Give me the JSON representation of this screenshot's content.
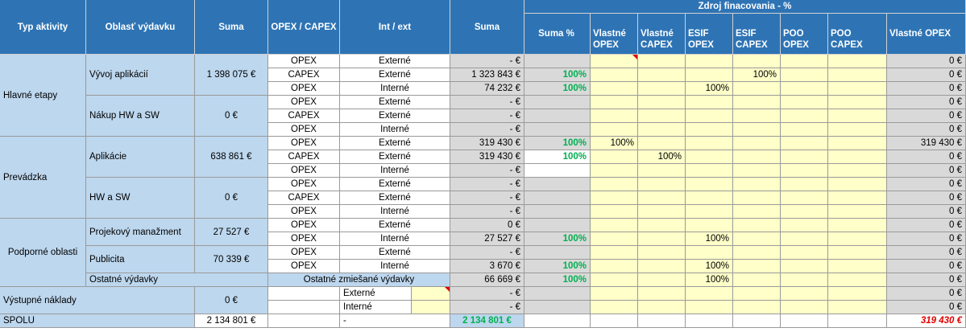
{
  "headers": {
    "typ_aktivity": "Typ aktivity",
    "oblast_vydavku": "Oblasť výdavku",
    "suma": "Suma",
    "opex_capex": "OPEX / CAPEX",
    "int_ext": "Int / ext",
    "suma2": "Suma",
    "zdroj": "Zdroj finacovania - %",
    "suma_pct": "Suma %",
    "vlastne_opex": "Vlastné OPEX",
    "vlastne_capex": "Vlastné CAPEX",
    "esif_opex": "ESIF OPEX",
    "esif_capex": "ESIF CAPEX",
    "poo_opex": "POO OPEX",
    "poo_capex": "POO CAPEX",
    "vlastne_opex2": "Vlastné OPEX"
  },
  "groups": {
    "hlavne": "Hlavné etapy",
    "prevadzka": "Prevádzka",
    "podporne": "Podporné oblasti",
    "vystupne": "Výstupné náklady",
    "spolu": "SPOLU"
  },
  "areas": {
    "vyvoj": "Vývoj aplikácií",
    "vyvoj_sum": "1 398 075 €",
    "nakup": "Nákup HW a SW",
    "nakup_sum": "0 €",
    "aplikacie": "Aplikácie",
    "aplikacie_sum": "638 861 €",
    "hwsw": "HW a SW",
    "hwsw_sum": "0 €",
    "projekt": "Projekový manažment",
    "projekt_sum": "27 527 €",
    "publicita": "Publicita",
    "publicita_sum": "70 339 €",
    "ostatne": "Ostatné výdavky",
    "vystupne_sum": "0 €",
    "spolu_sum": "2 134 801 €"
  },
  "rows": [
    {
      "oc": "OPEX",
      "ie": "Externé",
      "suma": "- €",
      "pct": "",
      "vo": "",
      "vc": "",
      "eo": "",
      "ec": "",
      "po": "",
      "pc": "",
      "v2": "0 €"
    },
    {
      "oc": "CAPEX",
      "ie": "Externé",
      "suma": "1 323 843 €",
      "pct": "100%",
      "vo": "",
      "vc": "",
      "eo": "",
      "ec": "100%",
      "po": "",
      "pc": "",
      "v2": "0 €"
    },
    {
      "oc": "OPEX",
      "ie": "Interné",
      "suma": "74 232 €",
      "pct": "100%",
      "vo": "",
      "vc": "",
      "eo": "100%",
      "ec": "",
      "po": "",
      "pc": "",
      "v2": "0 €"
    },
    {
      "oc": "OPEX",
      "ie": "Externé",
      "suma": "- €",
      "pct": "",
      "vo": "",
      "vc": "",
      "eo": "",
      "ec": "",
      "po": "",
      "pc": "",
      "v2": "0 €"
    },
    {
      "oc": "CAPEX",
      "ie": "Externé",
      "suma": "- €",
      "pct": "",
      "vo": "",
      "vc": "",
      "eo": "",
      "ec": "",
      "po": "",
      "pc": "",
      "v2": "0 €"
    },
    {
      "oc": "OPEX",
      "ie": "Interné",
      "suma": "- €",
      "pct": "",
      "vo": "",
      "vc": "",
      "eo": "",
      "ec": "",
      "po": "",
      "pc": "",
      "v2": "0 €"
    },
    {
      "oc": "OPEX",
      "ie": "Externé",
      "suma": "319 430 €",
      "pct": "100%",
      "vo": "100%",
      "vc": "",
      "eo": "",
      "ec": "",
      "po": "",
      "pc": "",
      "v2": "319 430 €"
    },
    {
      "oc": "CAPEX",
      "ie": "Externé",
      "suma": "319 430 €",
      "pct": "100%",
      "vo": "",
      "vc": "100%",
      "eo": "",
      "ec": "",
      "po": "",
      "pc": "",
      "v2": "0 €"
    },
    {
      "oc": "OPEX",
      "ie": "Interné",
      "suma": "- €",
      "pct": "",
      "vo": "",
      "vc": "",
      "eo": "",
      "ec": "",
      "po": "",
      "pc": "",
      "v2": "0 €"
    },
    {
      "oc": "OPEX",
      "ie": "Externé",
      "suma": "- €",
      "pct": "",
      "vo": "",
      "vc": "",
      "eo": "",
      "ec": "",
      "po": "",
      "pc": "",
      "v2": "0 €"
    },
    {
      "oc": "CAPEX",
      "ie": "Externé",
      "suma": "- €",
      "pct": "",
      "vo": "",
      "vc": "",
      "eo": "",
      "ec": "",
      "po": "",
      "pc": "",
      "v2": "0 €"
    },
    {
      "oc": "OPEX",
      "ie": "Interné",
      "suma": "- €",
      "pct": "",
      "vo": "",
      "vc": "",
      "eo": "",
      "ec": "",
      "po": "",
      "pc": "",
      "v2": "0 €"
    },
    {
      "oc": "OPEX",
      "ie": "Externé",
      "suma": "0 €",
      "pct": "",
      "vo": "",
      "vc": "",
      "eo": "",
      "ec": "",
      "po": "",
      "pc": "",
      "v2": "0 €"
    },
    {
      "oc": "OPEX",
      "ie": "Interné",
      "suma": "27 527 €",
      "pct": "100%",
      "vo": "",
      "vc": "",
      "eo": "100%",
      "ec": "",
      "po": "",
      "pc": "",
      "v2": "0 €"
    },
    {
      "oc": "OPEX",
      "ie": "Externé",
      "suma": "- €",
      "pct": "",
      "vo": "",
      "vc": "",
      "eo": "",
      "ec": "",
      "po": "",
      "pc": "",
      "v2": "0 €"
    },
    {
      "oc": "OPEX",
      "ie": "Interné",
      "suma": "3 670 €",
      "pct": "100%",
      "vo": "",
      "vc": "",
      "eo": "100%",
      "ec": "",
      "po": "",
      "pc": "",
      "v2": "0 €"
    },
    {
      "oc": "",
      "ie": "Ostatné zmiešané výdavky",
      "suma": "66 669 €",
      "pct": "100%",
      "vo": "",
      "vc": "",
      "eo": "100%",
      "ec": "",
      "po": "",
      "pc": "",
      "v2": "0 €"
    },
    {
      "oc": "",
      "ie": "Externé",
      "suma": "- €",
      "pct": "",
      "vo": "",
      "vc": "",
      "eo": "",
      "ec": "",
      "po": "",
      "pc": "",
      "v2": "0 €"
    },
    {
      "oc": "",
      "ie": "Interné",
      "suma": "- €",
      "pct": "",
      "vo": "",
      "vc": "",
      "eo": "",
      "ec": "",
      "po": "",
      "pc": "",
      "v2": "0 €"
    }
  ],
  "spolu_row": {
    "ie": "-",
    "suma": "2 134 801 €",
    "v2": "319 430 €"
  },
  "colors": {
    "header": "#2e74b5",
    "light_blue": "#bdd7ee",
    "grey": "#d9d9d9",
    "yellow": "#ffffc9",
    "green_text": "#00b050",
    "red_text": "#e00000"
  }
}
